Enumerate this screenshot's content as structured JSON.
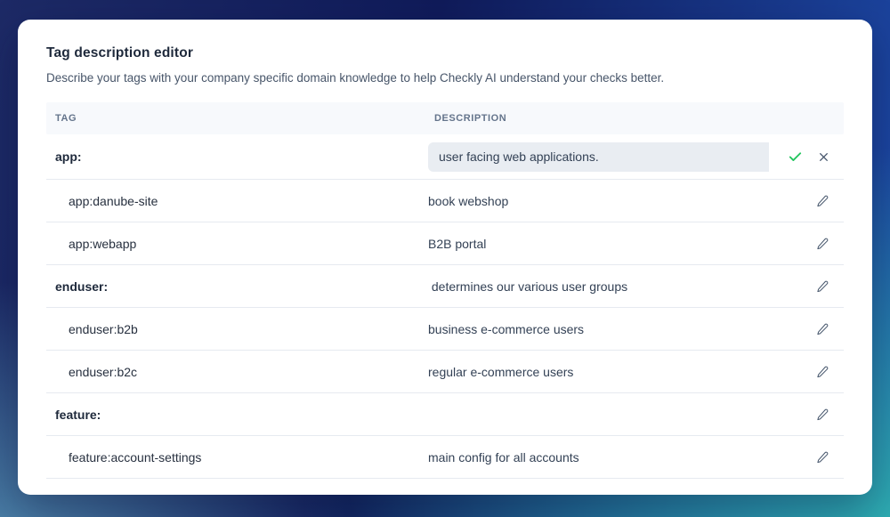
{
  "card": {
    "title": "Tag description editor",
    "subtitle": "Describe your tags with your company specific domain knowledge to help Checkly AI understand your checks better."
  },
  "table": {
    "headers": {
      "tag": "TAG",
      "description": "DESCRIPTION"
    },
    "rows": [
      {
        "tag": "app:",
        "style": "group",
        "state": "editing",
        "description": "user facing web applications.",
        "actions": [
          "check-icon",
          "x-icon"
        ]
      },
      {
        "tag": "app:danube-site",
        "style": "child",
        "state": "readonly",
        "description": "book webshop",
        "actions": [
          "pencil-icon"
        ]
      },
      {
        "tag": "app:webapp",
        "style": "child",
        "state": "readonly",
        "description": "B2B portal",
        "actions": [
          "pencil-icon"
        ]
      },
      {
        "tag": "enduser:",
        "style": "group",
        "state": "readonly",
        "description": " determines our various user groups",
        "actions": [
          "pencil-icon"
        ]
      },
      {
        "tag": "enduser:b2b",
        "style": "child",
        "state": "readonly",
        "description": "business e-commerce users",
        "actions": [
          "pencil-icon"
        ]
      },
      {
        "tag": "enduser:b2c",
        "style": "child",
        "state": "readonly",
        "description": "regular e-commerce users",
        "actions": [
          "pencil-icon"
        ]
      },
      {
        "tag": "feature:",
        "style": "group",
        "state": "readonly",
        "description": "",
        "actions": [
          "pencil-icon"
        ]
      },
      {
        "tag": "feature:account-settings",
        "style": "child",
        "state": "readonly",
        "description": "main config for all accounts",
        "actions": [
          "pencil-icon"
        ]
      }
    ]
  },
  "colors": {
    "confirm_green": "#22c55e",
    "icon_slate": "#44546a",
    "header_text": "#64748b",
    "row_divider": "#e6eaf0",
    "input_bg": "#e9edf2",
    "bg_navy": "#101b5a",
    "bg_blue": "#1d4aa8",
    "bg_teal": "#2fb2b2"
  }
}
